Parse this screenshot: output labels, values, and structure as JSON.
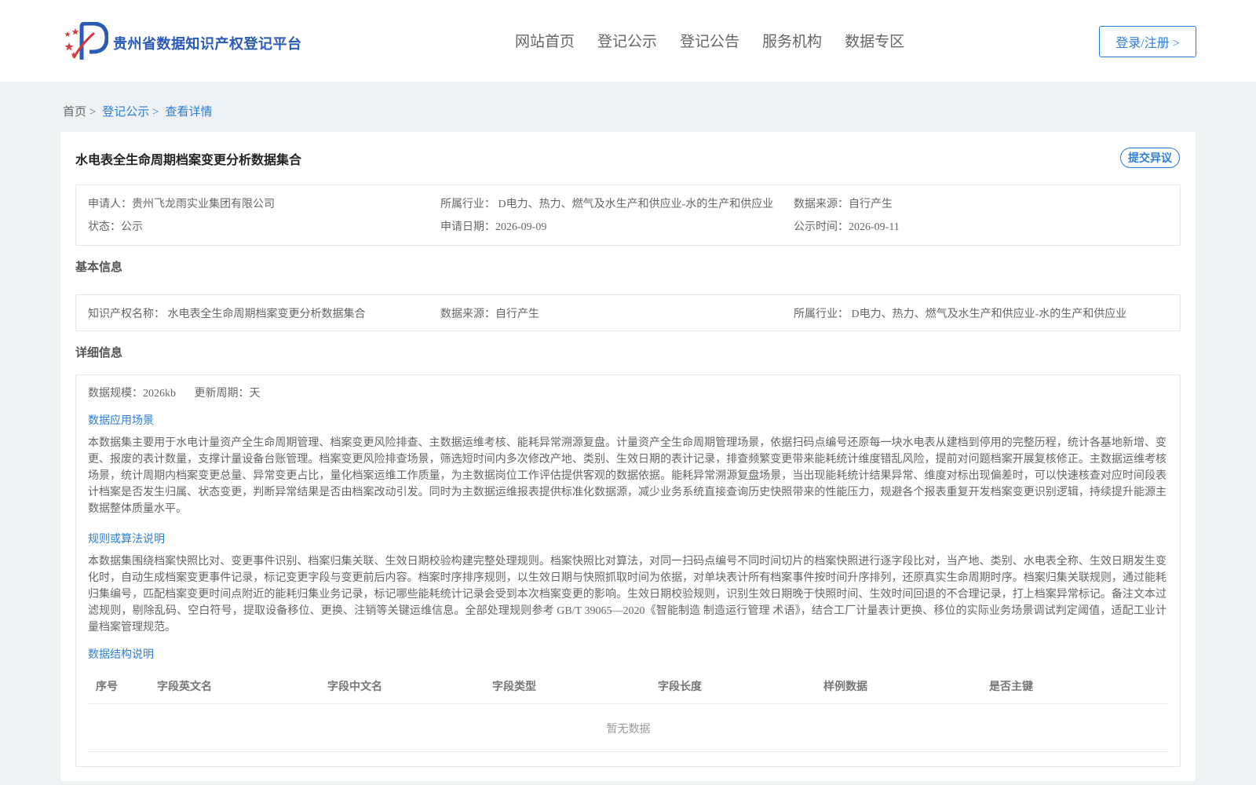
{
  "header": {
    "site_name": "贵州省数据知识产权登记平台",
    "nav": [
      "网站首页",
      "登记公示",
      "登记公告",
      "服务机构",
      "数据专区"
    ],
    "login_label": "登录/注册 >"
  },
  "breadcrumb": {
    "home": "首页 >",
    "section": "登记公示 >",
    "current": "查看详情"
  },
  "detail": {
    "title": "水电表全生命周期档案变更分析数据集合",
    "objection_label": "提交异议",
    "summary": {
      "applicant": "申请人：贵州飞龙雨实业集团有限公司",
      "industry": "所属行业： D电力、热力、燃气及水生产和供应业-水的生产和供应业",
      "source": "数据来源：自行产生",
      "status": "状态：公示",
      "apply_date": "申请日期：2026-09-09",
      "publish_date": "公示时间：2026-09-11"
    },
    "basic": {
      "section_title": "基本信息",
      "ip_name": "知识产权名称： 水电表全生命周期档案变更分析数据集合",
      "source": "数据来源：自行产生",
      "industry": "所属行业： D电力、热力、燃气及水生产和供应业-水的生产和供应业"
    },
    "more": {
      "section_title": "详细信息",
      "scale": "数据规模：2026kb",
      "cycle": "更新周期：天",
      "scenario_title": "数据应用场景",
      "scenario_text": "本数据集主要用于水电计量资产全生命周期管理、档案变更风险排查、主数据运维考核、能耗异常溯源复盘。计量资产全生命周期管理场景，依据扫码点编号还原每一块水电表从建档到停用的完整历程，统计各基地新增、变更、报废的表计数量，支撑计量设备台账管理。档案变更风险排查场景，筛选短时间内多次修改产地、类别、生效日期的表计记录，排查频繁变更带来能耗统计维度错乱风险，提前对问题档案开展复核修正。主数据运维考核场景，统计周期内档案变更总量、异常变更占比，量化档案运维工作质量，为主数据岗位工作评估提供客观的数据依据。能耗异常溯源复盘场景，当出现能耗统计结果异常、维度对标出现偏差时，可以快速核查对应时间段表计档案是否发生归属、状态变更，判断异常结果是否由档案改动引发。同时为主数据运维报表提供标准化数据源，减少业务系统直接查询历史快照带来的性能压力，规避各个报表重复开发档案变更识别逻辑，持续提升能源主数据整体质量水平。",
      "rule_title": "规则或算法说明",
      "rule_text": "本数据集围绕档案快照比对、变更事件识别、档案归集关联、生效日期校验构建完整处理规则。档案快照比对算法，对同一扫码点编号不同时间切片的档案快照进行逐字段比对，当产地、类别、水电表全称、生效日期发生变化时，自动生成档案变更事件记录，标记变更字段与变更前后内容。档案时序排序规则，以生效日期与快照抓取时间为依据，对单块表计所有档案事件按时间升序排列，还原真实生命周期时序。档案归集关联规则，通过能耗归集编号，匹配档案变更时间点附近的能耗归集业务记录，标记哪些能耗统计记录会受到本次档案变更的影响。生效日期校验规则，识别生效日期晚于快照时间、生效时间回退的不合理记录，打上档案异常标记。备注文本过滤规则，剔除乱码、空白符号，提取设备移位、更换、注销等关键运维信息。全部处理规则参考 GB/T 39065—2020《智能制造 制造运行管理 术语》，结合工厂计量表计更换、移位的实际业务场景调试判定阈值，适配工业计量档案管理规范。",
      "structure_title": "数据结构说明",
      "columns": [
        "序号",
        "字段英文名",
        "字段中文名",
        "字段类型",
        "字段长度",
        "样例数据",
        "是否主键"
      ],
      "empty_text": "暂无数据"
    }
  }
}
